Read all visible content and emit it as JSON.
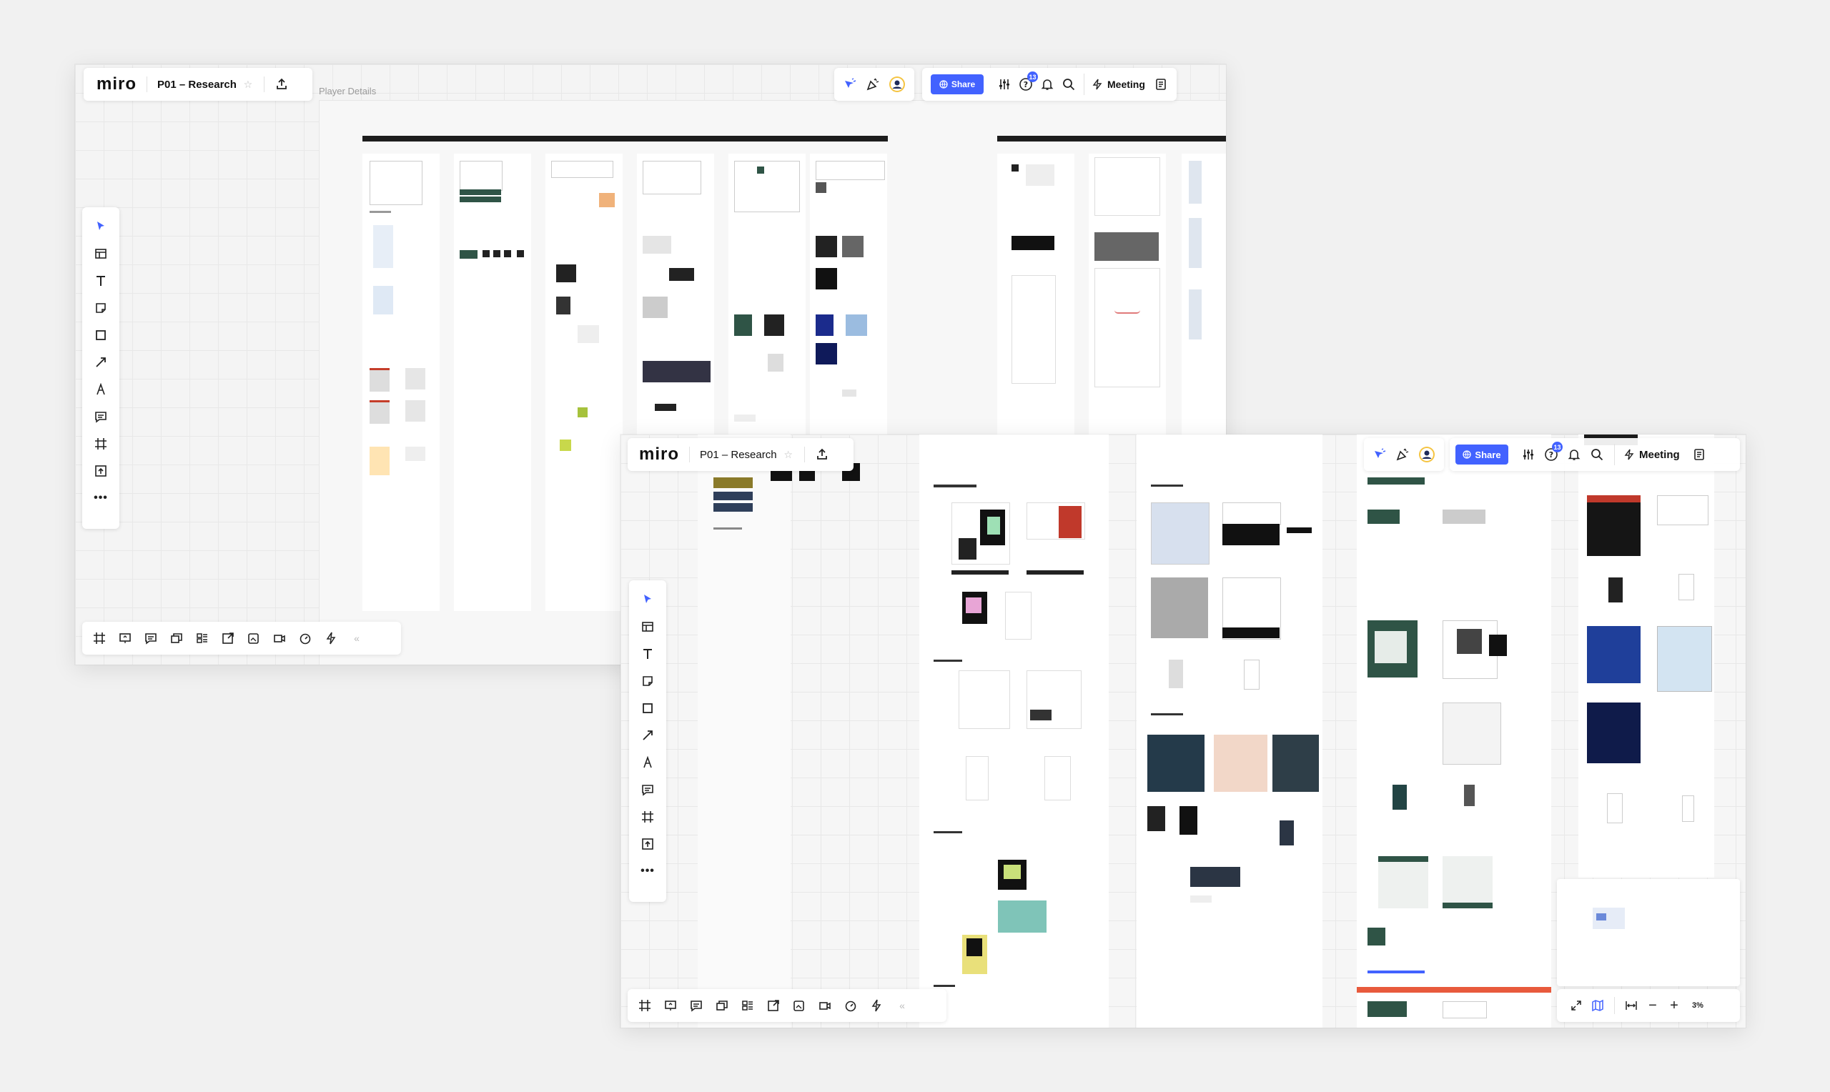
{
  "app": {
    "logo": "miro",
    "board_name": "P01 – Research",
    "share_label": "Share",
    "meeting_label": "Meeting",
    "help_badge": "13"
  },
  "canvas": {
    "frame_label": "Player Details"
  },
  "zoom": {
    "level": "3%"
  },
  "icons": {
    "select": "cursor-icon",
    "templates": "templates-icon",
    "text": "text-icon",
    "sticky": "sticky-note-icon",
    "shape": "shape-icon",
    "line": "arrow-line-icon",
    "pen": "pen-icon",
    "comment": "comment-icon",
    "frame": "frame-icon",
    "upload": "upload-icon",
    "more": "more-icon"
  },
  "colors": {
    "accent": "#4262ff",
    "canvas": "#f4f4f4",
    "section_red": "#e85a3c",
    "dark_green": "#2f5446"
  }
}
